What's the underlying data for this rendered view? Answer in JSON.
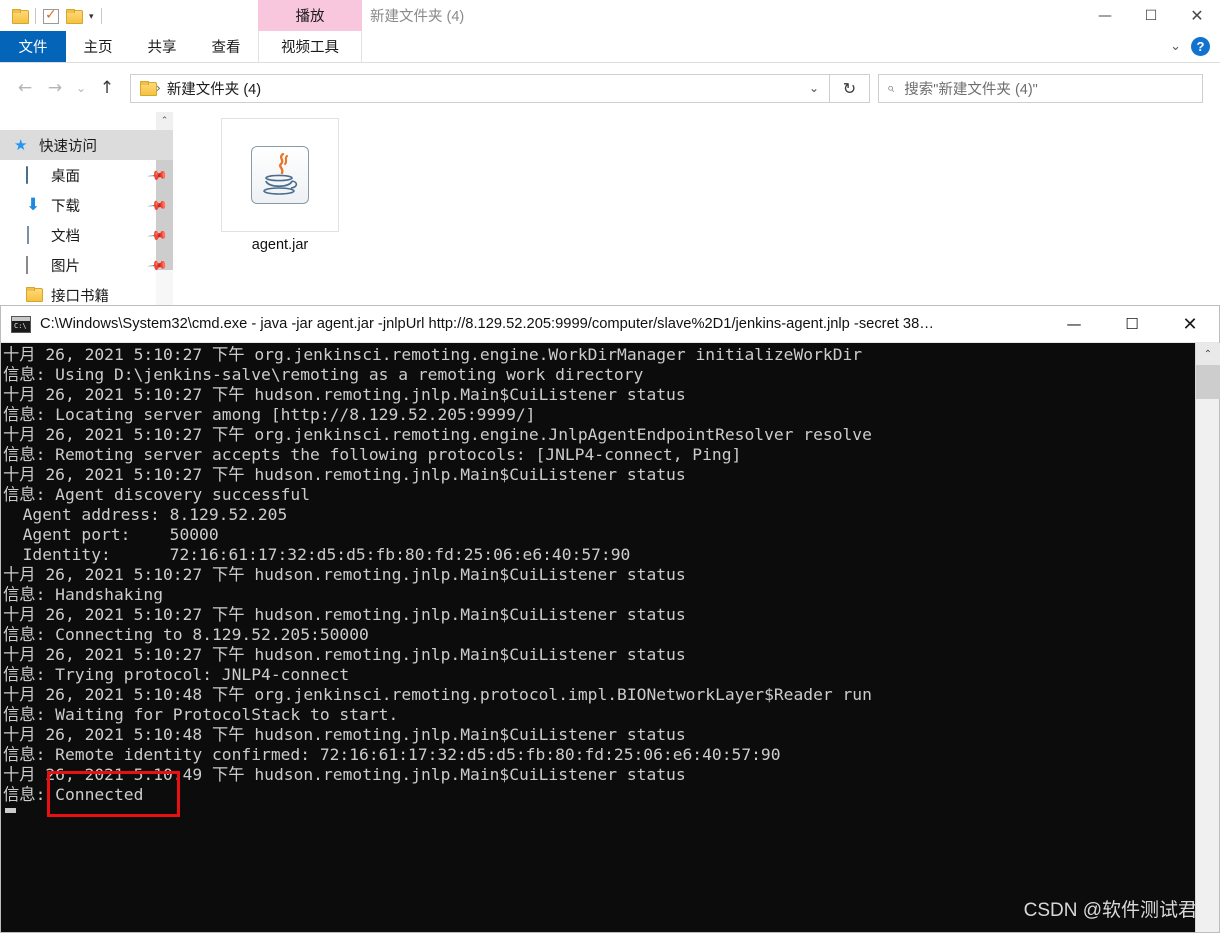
{
  "explorer": {
    "window_title": "新建文件夹 (4)",
    "quick_access_toolbar": [
      {
        "name": "folder-icon",
        "label": ""
      },
      {
        "name": "properties-checkbox-icon",
        "label": ""
      },
      {
        "name": "new-folder-icon",
        "label": ""
      },
      {
        "name": "customize-caret-icon",
        "label": "▾"
      }
    ],
    "contextual_tab_group": "播放",
    "contextual_tool_label": "视频工具",
    "ribbon_tabs": [
      {
        "label": "文件",
        "active": true
      },
      {
        "label": "主页",
        "active": false
      },
      {
        "label": "共享",
        "active": false
      },
      {
        "label": "查看",
        "active": false
      }
    ],
    "window_controls": {
      "minimize": "—",
      "maximize": "☐",
      "close": "✕"
    },
    "ribbon_right": {
      "collapse_caret": "⌄",
      "help": "?"
    },
    "navbar": {
      "back": "←",
      "forward": "→",
      "recent": "⌄",
      "up": "↑",
      "breadcrumb_separator": "›",
      "breadcrumb_path": "新建文件夹 (4)",
      "address_dropdown": "⌄",
      "refresh": "↻",
      "search_icon": "⌕",
      "search_placeholder": "搜索\"新建文件夹 (4)\""
    },
    "sidebar": {
      "collapse_arrow": "⌃",
      "items": [
        {
          "label": "快速访问",
          "icon": "quick-access-star-icon",
          "pinned": false,
          "selected": true
        },
        {
          "label": "桌面",
          "icon": "desktop-icon",
          "pinned": true,
          "selected": false
        },
        {
          "label": "下载",
          "icon": "downloads-icon",
          "pinned": true,
          "selected": false
        },
        {
          "label": "文档",
          "icon": "documents-icon",
          "pinned": true,
          "selected": false
        },
        {
          "label": "图片",
          "icon": "pictures-icon",
          "pinned": true,
          "selected": false
        },
        {
          "label": "接口书籍",
          "icon": "folder-icon",
          "pinned": false,
          "selected": false
        }
      ],
      "pin_glyph": "📌"
    },
    "files": [
      {
        "name": "agent.jar",
        "icon": "java-jar-icon"
      }
    ]
  },
  "console": {
    "title": "C:\\Windows\\System32\\cmd.exe - java  -jar agent.jar -jnlpUrl http://8.129.52.205:9999/computer/slave%2D1/jenkins-agent.jnlp -secret 38…",
    "icon": "cmd-prompt-icon",
    "window_controls": {
      "minimize": "—",
      "maximize": "☐",
      "close": "✕"
    },
    "scrollbar": {
      "arrow_up": "⌃"
    },
    "cursor": "▂",
    "lines": [
      "十月 26, 2021 5:10:27 下午 org.jenkinsci.remoting.engine.WorkDirManager initializeWorkDir",
      "信息: Using D:\\jenkins-salve\\remoting as a remoting work directory",
      "十月 26, 2021 5:10:27 下午 hudson.remoting.jnlp.Main$CuiListener status",
      "信息: Locating server among [http://8.129.52.205:9999/]",
      "十月 26, 2021 5:10:27 下午 org.jenkinsci.remoting.engine.JnlpAgentEndpointResolver resolve",
      "信息: Remoting server accepts the following protocols: [JNLP4-connect, Ping]",
      "十月 26, 2021 5:10:27 下午 hudson.remoting.jnlp.Main$CuiListener status",
      "信息: Agent discovery successful",
      "  Agent address: 8.129.52.205",
      "  Agent port:    50000",
      "  Identity:      72:16:61:17:32:d5:d5:fb:80:fd:25:06:e6:40:57:90",
      "十月 26, 2021 5:10:27 下午 hudson.remoting.jnlp.Main$CuiListener status",
      "信息: Handshaking",
      "十月 26, 2021 5:10:27 下午 hudson.remoting.jnlp.Main$CuiListener status",
      "信息: Connecting to 8.129.52.205:50000",
      "十月 26, 2021 5:10:27 下午 hudson.remoting.jnlp.Main$CuiListener status",
      "信息: Trying protocol: JNLP4-connect",
      "十月 26, 2021 5:10:48 下午 org.jenkinsci.remoting.protocol.impl.BIONetworkLayer$Reader run",
      "信息: Waiting for ProtocolStack to start.",
      "十月 26, 2021 5:10:48 下午 hudson.remoting.jnlp.Main$CuiListener status",
      "信息: Remote identity confirmed: 72:16:61:17:32:d5:d5:fb:80:fd:25:06:e6:40:57:90",
      "十月 26, 2021 5:10:49 下午 hudson.remoting.jnlp.Main$CuiListener status",
      "信息: Connected"
    ],
    "annotation": {
      "text": "Connected",
      "color": "#e81010"
    }
  },
  "watermark": "CSDN @软件测试君"
}
